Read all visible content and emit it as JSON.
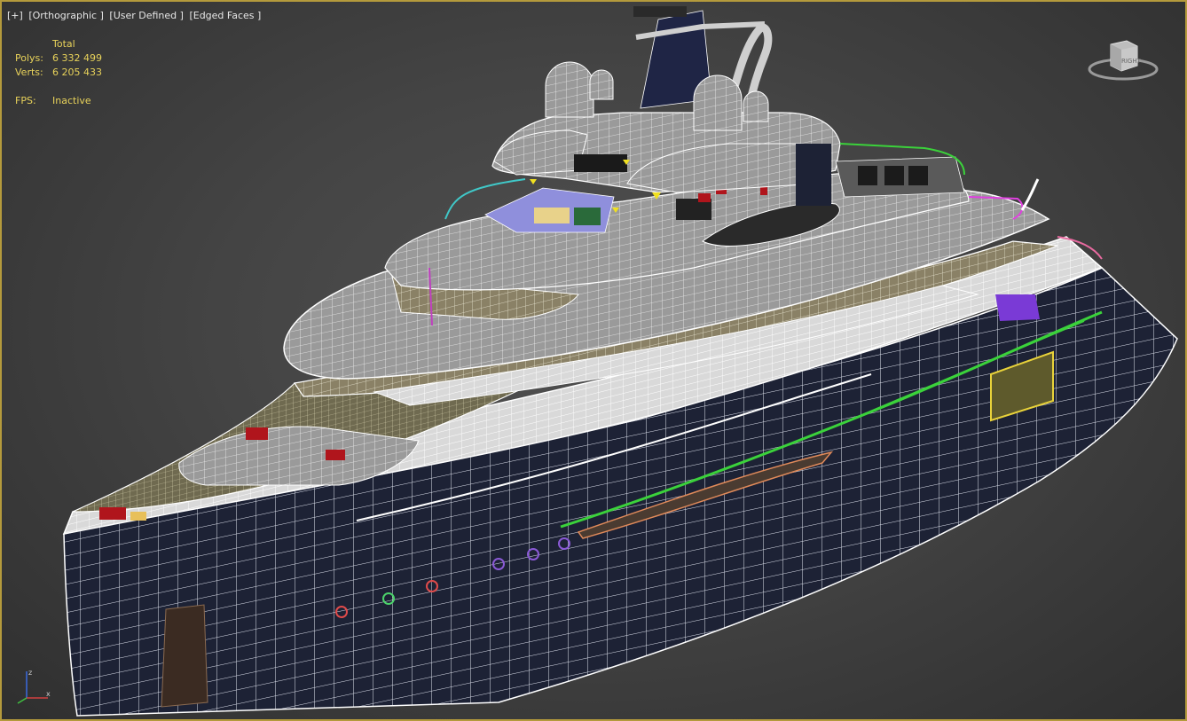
{
  "viewport": {
    "labels": [
      "[+]",
      "[Orthographic ]",
      "[User Defined ]",
      "[Edged Faces ]"
    ]
  },
  "stats": {
    "header": "Total",
    "polys_label": "Polys:",
    "polys_value": "6 332 499",
    "verts_label": "Verts:",
    "verts_value": "6 205 433",
    "fps_label": "FPS:",
    "fps_value": "Inactive"
  },
  "viewcube": {
    "face_label": "RIGHT"
  },
  "axis": {
    "z": "z",
    "x": "x"
  },
  "colors": {
    "border": "#b49a3c",
    "stats_text": "#e8d25a",
    "hull": "#1d2235",
    "wire": "#ffffff",
    "green_stripe": "#3bd23b"
  }
}
